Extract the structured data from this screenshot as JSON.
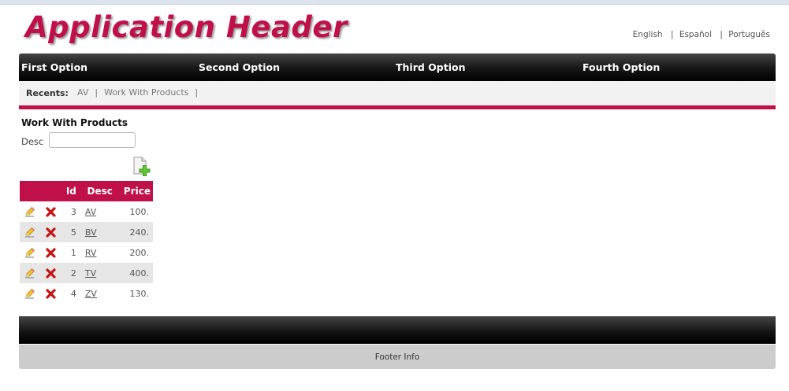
{
  "header": {
    "title": "Application Header"
  },
  "languages": [
    "English",
    "Español",
    "Português"
  ],
  "nav": {
    "items": [
      "First Option",
      "Second Option",
      "Third Option",
      "Fourth Option"
    ]
  },
  "recents": {
    "label": "Recents:",
    "items": [
      "AV",
      "Work With Products"
    ]
  },
  "main": {
    "title": "Work With Products",
    "filter": {
      "label": "Desc",
      "value": "",
      "placeholder": ""
    },
    "add_icon": "add-document-icon"
  },
  "grid": {
    "columns": [
      "",
      "",
      "Id",
      "Desc",
      "Price"
    ],
    "row_icons": {
      "edit": "pencil-icon",
      "delete": "delete-x-icon"
    },
    "rows": [
      {
        "id": "3",
        "desc": "AV",
        "price": "100."
      },
      {
        "id": "5",
        "desc": "BV",
        "price": "240."
      },
      {
        "id": "1",
        "desc": "RV",
        "price": "200."
      },
      {
        "id": "2",
        "desc": "TV",
        "price": "400."
      },
      {
        "id": "4",
        "desc": "ZV",
        "price": "130."
      }
    ]
  },
  "footer": {
    "text": "Footer Info"
  },
  "colors": {
    "accent": "#c0104a",
    "bar": "#000000",
    "footer": "#cccccc"
  }
}
